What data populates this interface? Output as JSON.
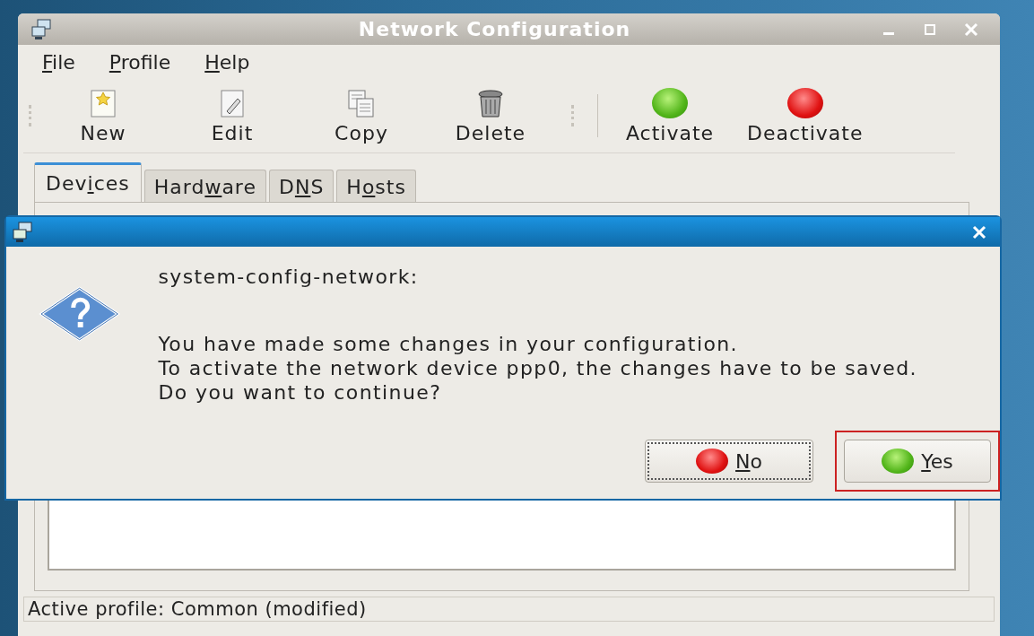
{
  "window": {
    "title": "Network Configuration"
  },
  "menu": [
    {
      "label": {
        "key": "F",
        "post": "ile"
      }
    },
    {
      "label": {
        "key": "P",
        "post": "rofile"
      }
    },
    {
      "label": {
        "key": "H",
        "post": "elp"
      }
    }
  ],
  "toolbar": [
    {
      "kind": "new",
      "label": "New"
    },
    {
      "kind": "edit",
      "label": "Edit"
    },
    {
      "kind": "copy",
      "label": "Copy"
    },
    {
      "kind": "delete",
      "label": "Delete"
    },
    {
      "kind": "separator"
    },
    {
      "kind": "activate",
      "label": "Activate"
    },
    {
      "kind": "deactivate",
      "label": "Deactivate"
    }
  ],
  "tabs": [
    {
      "label": {
        "pre": "Dev",
        "key": "i",
        "post": "ces"
      },
      "selected": true
    },
    {
      "label": {
        "pre": "Hard",
        "key": "w",
        "post": "are"
      },
      "selected": false
    },
    {
      "label": {
        "pre": "D",
        "key": "N",
        "post": "S"
      },
      "selected": false
    },
    {
      "label": {
        "pre": "H",
        "key": "o",
        "post": "sts"
      },
      "selected": false
    }
  ],
  "dialog": {
    "heading": "system-config-network:",
    "message": [
      "You have made some changes in your configuration.",
      "To activate the network device ppp0, the changes have to be saved.",
      "Do you want to continue?"
    ],
    "buttons": [
      {
        "kind": "no",
        "label": {
          "key": "N",
          "post": "o"
        },
        "focused": true,
        "highlighted": false
      },
      {
        "kind": "yes",
        "label": {
          "key": "Y",
          "post": "es"
        },
        "focused": false,
        "highlighted": true
      }
    ]
  },
  "status_bar": "Active profile: Common (modified)"
}
